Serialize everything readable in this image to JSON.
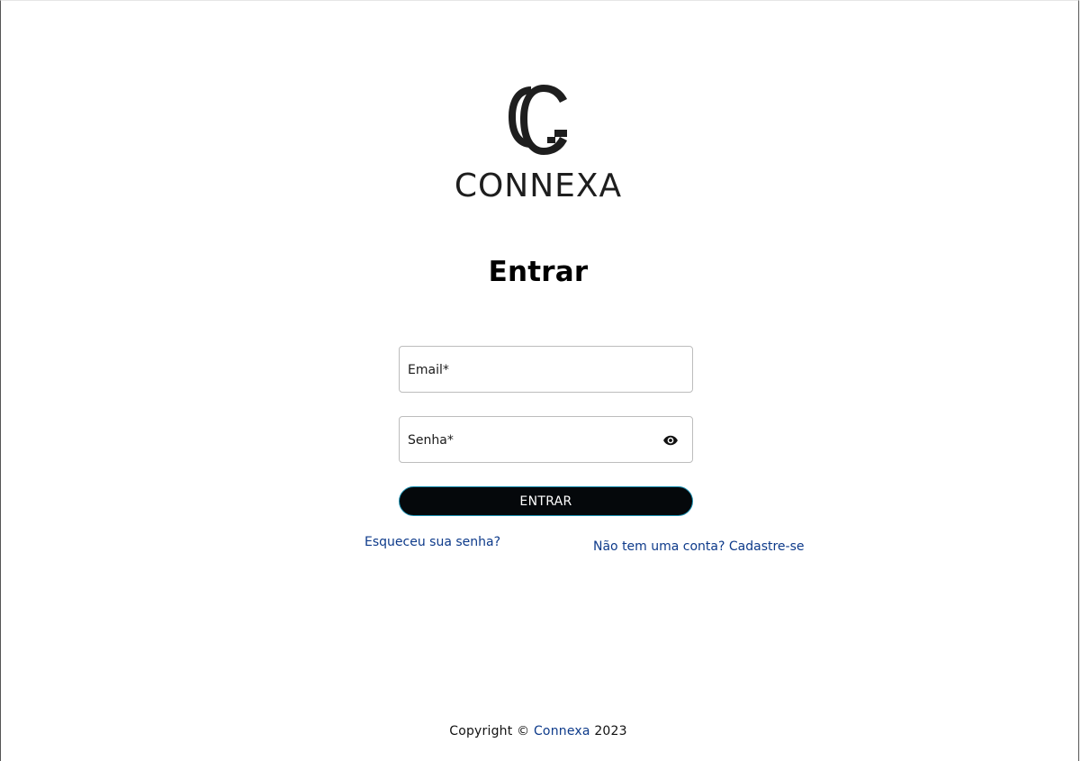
{
  "brand": {
    "name": "CONNEXA",
    "logo_icon": "interlocking-c-logo-icon"
  },
  "login": {
    "title": "Entrar",
    "email_label": "Email*",
    "password_label": "Senha*",
    "password_toggle_icon": "eye-icon",
    "submit_label": "ENTRAR",
    "forgot_link": "Esqueceu sua senha?",
    "signup_link": "Não tem uma conta? Cadastre-se"
  },
  "footer": {
    "prefix": "Copyright © ",
    "brand_link": "Connexa",
    "year": " 2023"
  },
  "colors": {
    "link": "#0d3a8a",
    "button_bg": "#05080b",
    "button_border": "#1b8fb0",
    "text": "#000000"
  }
}
